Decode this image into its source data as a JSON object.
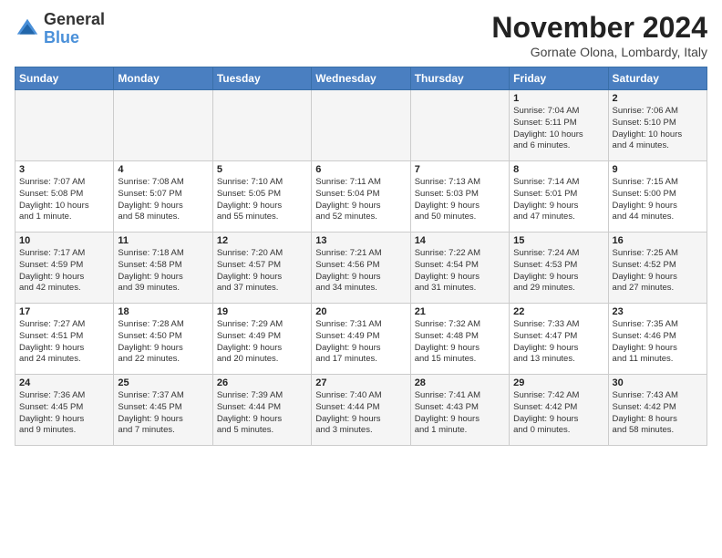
{
  "logo": {
    "line1": "General",
    "line2": "Blue"
  },
  "header": {
    "month": "November 2024",
    "location": "Gornate Olona, Lombardy, Italy"
  },
  "weekdays": [
    "Sunday",
    "Monday",
    "Tuesday",
    "Wednesday",
    "Thursday",
    "Friday",
    "Saturday"
  ],
  "weeks": [
    [
      {
        "day": "",
        "info": ""
      },
      {
        "day": "",
        "info": ""
      },
      {
        "day": "",
        "info": ""
      },
      {
        "day": "",
        "info": ""
      },
      {
        "day": "",
        "info": ""
      },
      {
        "day": "1",
        "info": "Sunrise: 7:04 AM\nSunset: 5:11 PM\nDaylight: 10 hours\nand 6 minutes."
      },
      {
        "day": "2",
        "info": "Sunrise: 7:06 AM\nSunset: 5:10 PM\nDaylight: 10 hours\nand 4 minutes."
      }
    ],
    [
      {
        "day": "3",
        "info": "Sunrise: 7:07 AM\nSunset: 5:08 PM\nDaylight: 10 hours\nand 1 minute."
      },
      {
        "day": "4",
        "info": "Sunrise: 7:08 AM\nSunset: 5:07 PM\nDaylight: 9 hours\nand 58 minutes."
      },
      {
        "day": "5",
        "info": "Sunrise: 7:10 AM\nSunset: 5:05 PM\nDaylight: 9 hours\nand 55 minutes."
      },
      {
        "day": "6",
        "info": "Sunrise: 7:11 AM\nSunset: 5:04 PM\nDaylight: 9 hours\nand 52 minutes."
      },
      {
        "day": "7",
        "info": "Sunrise: 7:13 AM\nSunset: 5:03 PM\nDaylight: 9 hours\nand 50 minutes."
      },
      {
        "day": "8",
        "info": "Sunrise: 7:14 AM\nSunset: 5:01 PM\nDaylight: 9 hours\nand 47 minutes."
      },
      {
        "day": "9",
        "info": "Sunrise: 7:15 AM\nSunset: 5:00 PM\nDaylight: 9 hours\nand 44 minutes."
      }
    ],
    [
      {
        "day": "10",
        "info": "Sunrise: 7:17 AM\nSunset: 4:59 PM\nDaylight: 9 hours\nand 42 minutes."
      },
      {
        "day": "11",
        "info": "Sunrise: 7:18 AM\nSunset: 4:58 PM\nDaylight: 9 hours\nand 39 minutes."
      },
      {
        "day": "12",
        "info": "Sunrise: 7:20 AM\nSunset: 4:57 PM\nDaylight: 9 hours\nand 37 minutes."
      },
      {
        "day": "13",
        "info": "Sunrise: 7:21 AM\nSunset: 4:56 PM\nDaylight: 9 hours\nand 34 minutes."
      },
      {
        "day": "14",
        "info": "Sunrise: 7:22 AM\nSunset: 4:54 PM\nDaylight: 9 hours\nand 31 minutes."
      },
      {
        "day": "15",
        "info": "Sunrise: 7:24 AM\nSunset: 4:53 PM\nDaylight: 9 hours\nand 29 minutes."
      },
      {
        "day": "16",
        "info": "Sunrise: 7:25 AM\nSunset: 4:52 PM\nDaylight: 9 hours\nand 27 minutes."
      }
    ],
    [
      {
        "day": "17",
        "info": "Sunrise: 7:27 AM\nSunset: 4:51 PM\nDaylight: 9 hours\nand 24 minutes."
      },
      {
        "day": "18",
        "info": "Sunrise: 7:28 AM\nSunset: 4:50 PM\nDaylight: 9 hours\nand 22 minutes."
      },
      {
        "day": "19",
        "info": "Sunrise: 7:29 AM\nSunset: 4:49 PM\nDaylight: 9 hours\nand 20 minutes."
      },
      {
        "day": "20",
        "info": "Sunrise: 7:31 AM\nSunset: 4:49 PM\nDaylight: 9 hours\nand 17 minutes."
      },
      {
        "day": "21",
        "info": "Sunrise: 7:32 AM\nSunset: 4:48 PM\nDaylight: 9 hours\nand 15 minutes."
      },
      {
        "day": "22",
        "info": "Sunrise: 7:33 AM\nSunset: 4:47 PM\nDaylight: 9 hours\nand 13 minutes."
      },
      {
        "day": "23",
        "info": "Sunrise: 7:35 AM\nSunset: 4:46 PM\nDaylight: 9 hours\nand 11 minutes."
      }
    ],
    [
      {
        "day": "24",
        "info": "Sunrise: 7:36 AM\nSunset: 4:45 PM\nDaylight: 9 hours\nand 9 minutes."
      },
      {
        "day": "25",
        "info": "Sunrise: 7:37 AM\nSunset: 4:45 PM\nDaylight: 9 hours\nand 7 minutes."
      },
      {
        "day": "26",
        "info": "Sunrise: 7:39 AM\nSunset: 4:44 PM\nDaylight: 9 hours\nand 5 minutes."
      },
      {
        "day": "27",
        "info": "Sunrise: 7:40 AM\nSunset: 4:44 PM\nDaylight: 9 hours\nand 3 minutes."
      },
      {
        "day": "28",
        "info": "Sunrise: 7:41 AM\nSunset: 4:43 PM\nDaylight: 9 hours\nand 1 minute."
      },
      {
        "day": "29",
        "info": "Sunrise: 7:42 AM\nSunset: 4:42 PM\nDaylight: 9 hours\nand 0 minutes."
      },
      {
        "day": "30",
        "info": "Sunrise: 7:43 AM\nSunset: 4:42 PM\nDaylight: 8 hours\nand 58 minutes."
      }
    ]
  ]
}
